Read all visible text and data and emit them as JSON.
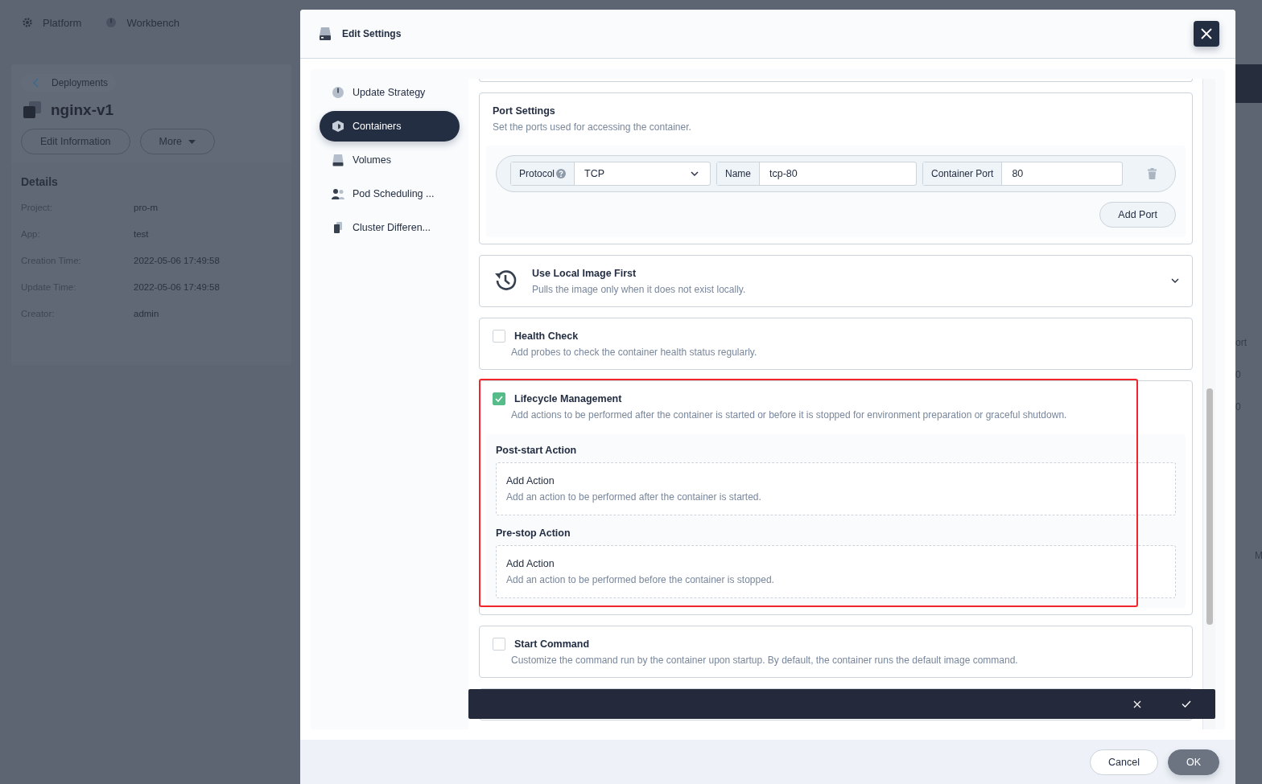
{
  "background": {
    "top_nav": [
      {
        "label": "Platform"
      },
      {
        "label": "Workbench"
      }
    ],
    "breadcrumb": "Deployments",
    "title": "nginx-v1",
    "buttons": [
      "Edit Information",
      "More"
    ],
    "details_title": "Details",
    "details": [
      {
        "label": "Project:",
        "value": "pro-m"
      },
      {
        "label": "App:",
        "value": "test"
      },
      {
        "label": "Creation Time:",
        "value": "2022-05-06 17:49:58"
      },
      {
        "label": "Update Time:",
        "value": "2022-05-06 17:49:58"
      },
      {
        "label": "Creator:",
        "value": "admin"
      }
    ],
    "right_column_header": "ort",
    "right_cells": [
      "0",
      "0"
    ],
    "right_tab": "M"
  },
  "modal": {
    "title": "Edit Settings",
    "nav": [
      {
        "label": "Update Strategy",
        "selected": false
      },
      {
        "label": "Containers",
        "selected": true
      },
      {
        "label": "Volumes",
        "selected": false
      },
      {
        "label": "Pod Scheduling ...",
        "selected": false
      },
      {
        "label": "Cluster Differen...",
        "selected": false
      }
    ],
    "port_settings": {
      "title": "Port Settings",
      "description": "Set the ports used for accessing the container.",
      "ports": [
        {
          "protocol_label": "Protocol",
          "protocol": "TCP",
          "name_label": "Name",
          "name": "tcp-80",
          "port_label": "Container Port",
          "port": "80"
        }
      ],
      "add_button": "Add Port"
    },
    "sections": [
      {
        "kind": "collapse",
        "title": "Use Local Image First",
        "description": "Pulls the image only when it does not exist locally."
      },
      {
        "kind": "checkbox",
        "checked": false,
        "title": "Health Check",
        "description": "Add probes to check the container health status regularly."
      },
      {
        "kind": "checkbox",
        "checked": true,
        "highlighted": true,
        "title": "Lifecycle Management",
        "description": "Add actions to be performed after the container is started or before it is stopped for environment preparation or graceful shutdown.",
        "groups": [
          {
            "title": "Post-start Action",
            "action_title": "Add Action",
            "action_description": "Add an action to be performed after the container is started."
          },
          {
            "title": "Pre-stop Action",
            "action_title": "Add Action",
            "action_description": "Add an action to be performed before the container is stopped."
          }
        ]
      },
      {
        "kind": "checkbox",
        "checked": false,
        "title": "Start Command",
        "description": "Customize the command run by the container upon startup. By default, the container runs the default image command."
      }
    ],
    "footer_buttons": [
      {
        "label": "Cancel",
        "kind": "secondary"
      },
      {
        "label": "OK",
        "kind": "primary"
      }
    ]
  }
}
